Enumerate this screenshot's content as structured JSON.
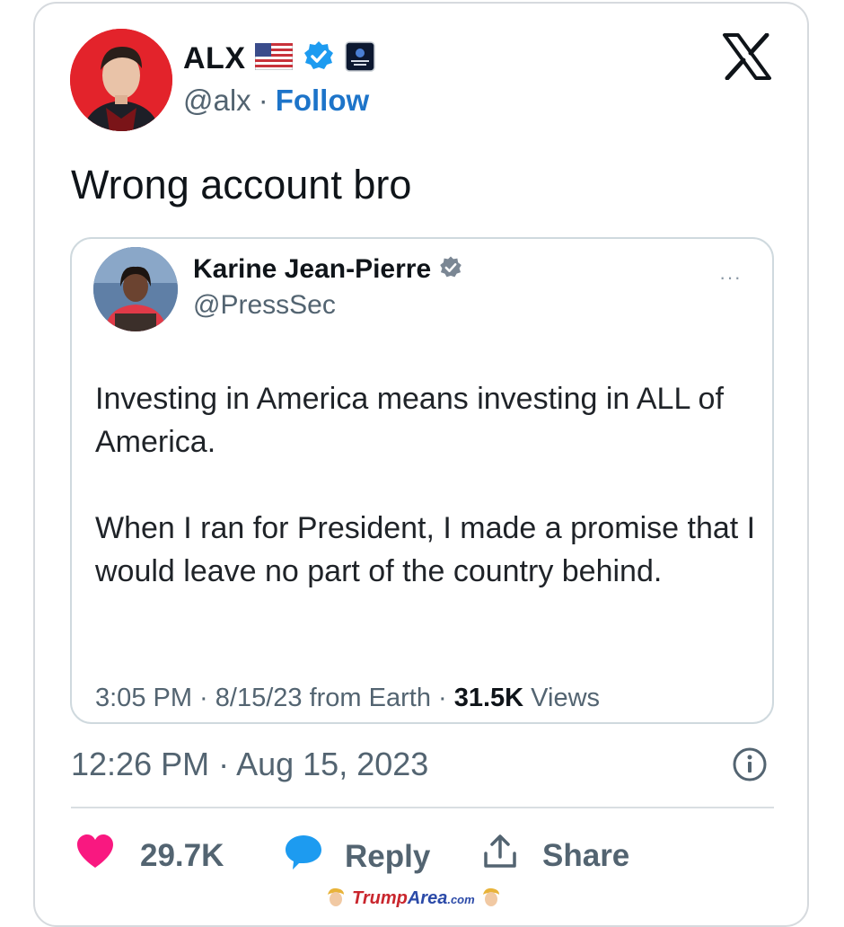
{
  "tweet": {
    "author_name": "ALX",
    "handle": "@alx",
    "separator": "·",
    "follow_label": "Follow",
    "text": "Wrong account bro",
    "timestamp": "12:26 PM · Aug 15, 2023"
  },
  "quoted": {
    "author_name": "Karine Jean-Pierre",
    "handle": "@PressSec",
    "more": "···",
    "paragraphs": [
      "Investing in America means investing in ALL of America.",
      "When I ran for President, I made a promise that I would leave no part of the country behind."
    ],
    "meta_prefix": "3:05 PM · 8/15/23 from Earth · ",
    "views_count": "31.5K",
    "views_label": " Views"
  },
  "actions": {
    "likes": "29.7K",
    "reply_label": "Reply",
    "share_label": "Share"
  },
  "watermark": {
    "brand_a": "Trump",
    "brand_b": "Area",
    "suffix": ".com"
  },
  "icons": [
    "us-flag-icon",
    "verified-badge-icon",
    "affiliate-badge-icon",
    "x-logo-icon",
    "info-icon",
    "heart-icon",
    "reply-bubble-icon",
    "share-icon"
  ],
  "colors": {
    "accent": "#1d74c9",
    "heart": "#f91880",
    "verified": "#1d9bf0",
    "quoted_verified": "#7b8794"
  }
}
